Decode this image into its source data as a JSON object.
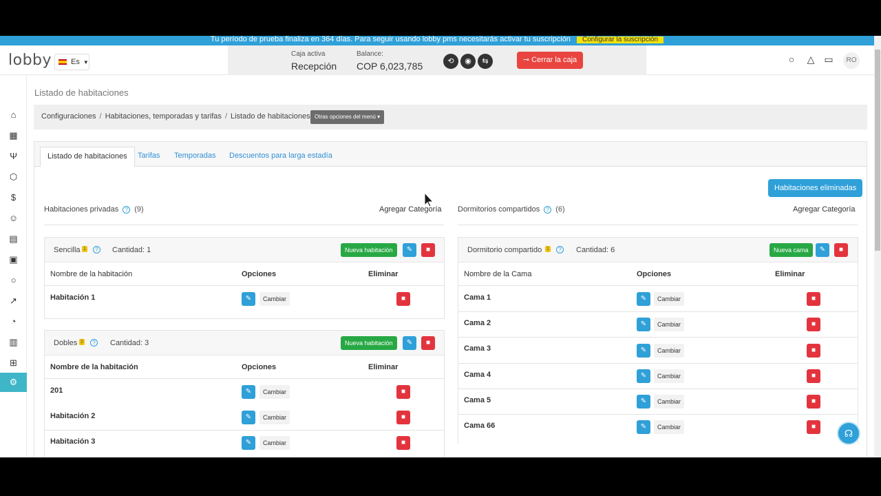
{
  "banner": {
    "text": "Tu período de prueba finaliza en 364 días. Para seguir usando lobby pms necesitarás activar tu suscripción",
    "button": "Configurar la suscripción"
  },
  "header": {
    "logo": "lobby",
    "language": "Es",
    "cashbox": {
      "active_label": "Caja activa",
      "active_value": "Recepción",
      "balance_label": "Balance:",
      "balance_value": "COP 6,023,785"
    },
    "close_cash": "Cerrar la caja",
    "avatar": "RO"
  },
  "page": {
    "title": "Listado de habitaciones"
  },
  "breadcrumb": {
    "items": [
      "Configuraciones",
      "Habitaciones, temporadas y tarifas",
      "Listado de habitaciones"
    ],
    "dropdown": "Otras opciones del menú"
  },
  "tabs": [
    "Listado de habitaciones",
    "Tarifas",
    "Temporadas",
    "Descuentos para larga estadía"
  ],
  "deleted_rooms_button": "Habitaciones eliminadas",
  "private": {
    "title": "Habitaciones privadas",
    "count": "(9)",
    "add_category": "Agregar Categoría",
    "categories": [
      {
        "name": "Sencilla",
        "badge": "1",
        "quantity": "Cantidad: 1",
        "new_button": "Nueva habitación",
        "col_name": "Nombre de la habitación",
        "col_options": "Opciones",
        "col_delete": "Eliminar",
        "rows": [
          "Habitación 1"
        ]
      },
      {
        "name": "Dobles",
        "badge": "2",
        "quantity": "Cantidad: 3",
        "new_button": "Nueva habitación",
        "col_name": "Nombre de la habitación",
        "col_options": "Opciones",
        "col_delete": "Eliminar",
        "rows": [
          "201",
          "Habitación 2",
          "Habitación 3"
        ]
      }
    ]
  },
  "shared": {
    "title": "Dormitorios compartidos",
    "count": "(6)",
    "add_category": "Agregar Categoría",
    "category": {
      "name": "Dormitorio compartido",
      "badge": "1",
      "quantity": "Cantidad: 6",
      "new_button": "Nueva cama",
      "col_name": "Nombre de la Cama",
      "col_options": "Opciones",
      "col_delete": "Eliminar",
      "rows": [
        "Cama 1",
        "Cama 2",
        "Cama 3",
        "Cama 4",
        "Cama 5",
        "Cama 66"
      ]
    }
  },
  "change_label": "Cambiar",
  "colors": {
    "primary": "#2fa0d8",
    "success": "#27a844",
    "danger": "#e3343e",
    "active_nav": "#3fb6c8",
    "badge": "#f1c40f"
  }
}
